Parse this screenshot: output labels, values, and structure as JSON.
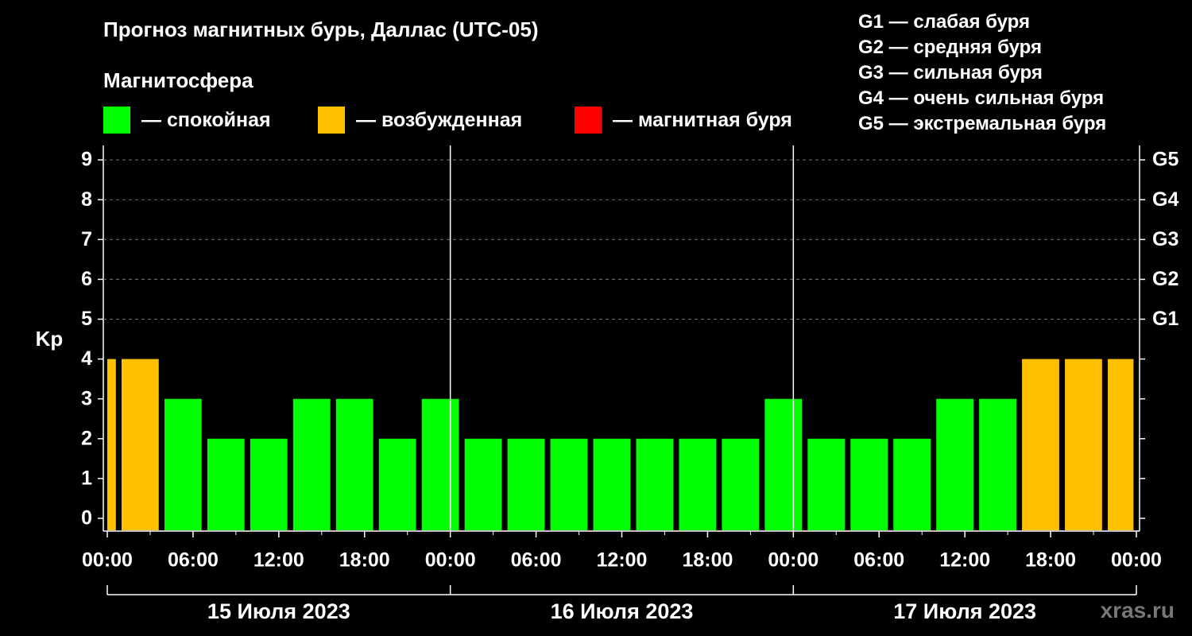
{
  "title": "Прогноз магнитных бурь, Даллас (UTC-05)",
  "subtitle": "Магнитосфера",
  "legend": [
    {
      "label": "— спокойная",
      "color": "#00ff00"
    },
    {
      "label": "— возбужденная",
      "color": "#ffc000"
    },
    {
      "label": "— магнитная буря",
      "color": "#ff0000"
    }
  ],
  "g_legend": [
    "G1 — слабая буря",
    "G2 — средняя буря",
    "G3 — сильная буря",
    "G4 — очень сильная буря",
    "G5 — экстремальная буря"
  ],
  "watermark": "xras.ru",
  "chart_data": {
    "type": "bar",
    "ylabel": "Kp",
    "ylim": [
      0,
      9
    ],
    "yticks": [
      "0",
      "1",
      "2",
      "3",
      "4",
      "5",
      "6",
      "7",
      "8",
      "9"
    ],
    "right_ticks": [
      {
        "kp": 5,
        "label": "G1"
      },
      {
        "kp": 6,
        "label": "G2"
      },
      {
        "kp": 7,
        "label": "G3"
      },
      {
        "kp": 8,
        "label": "G4"
      },
      {
        "kp": 9,
        "label": "G5"
      }
    ],
    "xtick_labels": [
      "00:00",
      "06:00",
      "12:00",
      "18:00",
      "00:00",
      "06:00",
      "12:00",
      "18:00",
      "00:00",
      "06:00",
      "12:00",
      "18:00",
      "00:00"
    ],
    "days": [
      "15 Июля 2023",
      "16 Июля 2023",
      "17 Июля 2023"
    ],
    "values": [
      4,
      4,
      3,
      2,
      2,
      3,
      3,
      2,
      3,
      2,
      2,
      2,
      2,
      2,
      2,
      2,
      3,
      2,
      2,
      2,
      3,
      3,
      4,
      4,
      4
    ],
    "colors": {
      "quiet": "#00ff00",
      "active": "#ffc000",
      "storm": "#ff0000"
    },
    "grid": true
  }
}
